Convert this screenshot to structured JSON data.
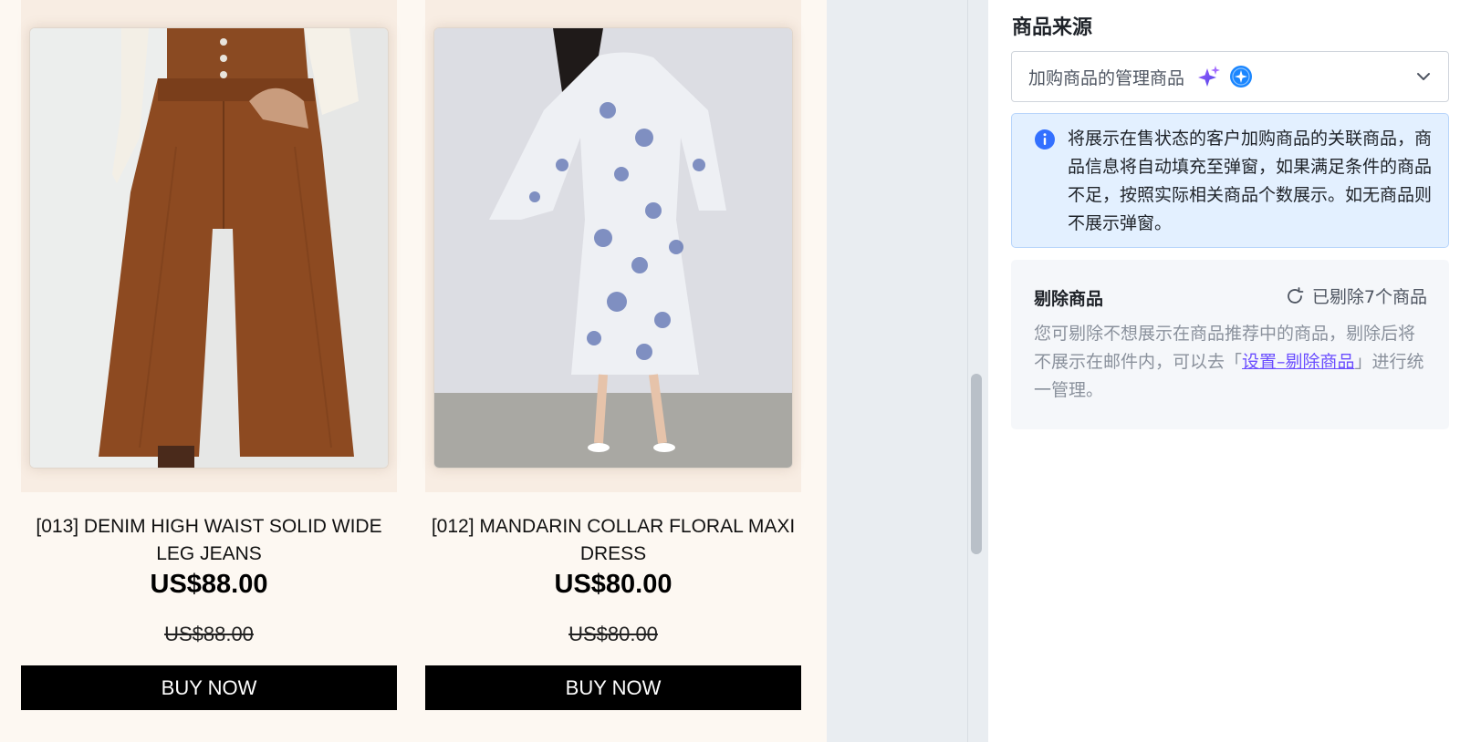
{
  "products": [
    {
      "title": "[013] DENIM HIGH WAIST SOLID WIDE LEG JEANS",
      "price": "US$88.00",
      "original_price": "US$88.00",
      "buy_label": "BUY NOW"
    },
    {
      "title": "[012] MANDARIN COLLAR FLORAL MAXI DRESS",
      "price": "US$80.00",
      "original_price": "US$80.00",
      "buy_label": "BUY NOW"
    }
  ],
  "panel": {
    "section_title": "商品来源",
    "source_select": {
      "value": "加购商品的管理商品",
      "icons": [
        "sparkle-icon",
        "ai-badge-icon",
        "chevron-down-icon"
      ]
    },
    "info_text": "将展示在售状态的客户加购商品的关联商品，商品信息将自动填充至弹窗，如果满足条件的商品不足，按照实际相关商品个数展示。如无商品则不展示弹窗。",
    "remove": {
      "title": "剔除商品",
      "link_label": "已剔除7个商品",
      "desc_prefix": "您可剔除不想展示在商品推荐中的商品，剔除后将不展示在邮件内，可以去「",
      "desc_link": "设置–剔除商品",
      "desc_suffix": "」进行统一管理。"
    }
  },
  "colors": {
    "canvas_bg": "#fdf8f2",
    "button_bg": "#000000",
    "info_bg": "#e3f0ff",
    "link": "#6a4dff"
  }
}
